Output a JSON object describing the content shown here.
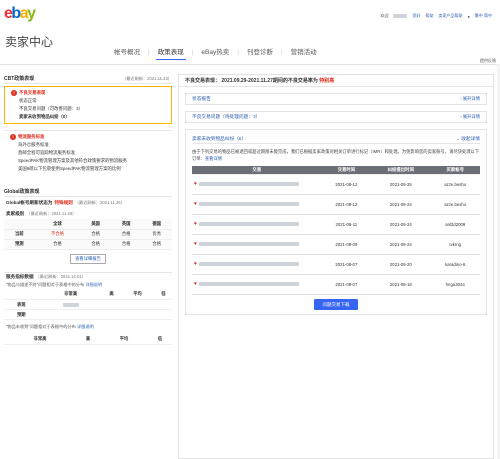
{
  "header": {
    "username": "",
    "account": "",
    "hello": "欢迎",
    "links": [
      "您好",
      "帮助",
      "卖家产品帮助"
    ],
    "lang": "繁中 简中"
  },
  "title": "卖家中心",
  "nav": [
    "帐号概况",
    "政策表现",
    "eBay热卖",
    "刊登诊断",
    "营销活动"
  ],
  "nav_active": 1,
  "feedback": "提供反馈",
  "left": {
    "cbt_title": "CBT政策表现",
    "cbt_date": "（最近刷新：2021.11.23）",
    "bad_title": "不良交易表现",
    "bad_items": [
      "状态正常",
      "不良交易问题（可改善问题：3）",
      "卖家未收到物品纠纷（0）"
    ],
    "bad_count3": "3",
    "ship_title": "物流服务标准",
    "ship_items": [
      "海外仓服务标准",
      "直邮全程可追踪物流服务标准",
      "SpeedPAK物流管理方案及其他符合政策要求的物流服务",
      "美国6磅以下包裹使用SpeedPAK物流管理方案的比例"
    ],
    "global_title": "Global政策表现",
    "global_status_label": "Global帐号刷新状态为",
    "global_status": "特殊规则",
    "global_date": "（最近刷新：2021.11.26）",
    "seller_title": "卖家级别",
    "seller_date": "（最近刷新：2021.11.26）",
    "seller_table": {
      "headers": [
        "",
        "全球",
        "美国",
        "英国",
        "德国"
      ],
      "rows": [
        [
          "当前",
          "不合格",
          "合格",
          "合格",
          "优秀"
        ],
        [
          "预测",
          "合格",
          "合格",
          "合格",
          "合格"
        ]
      ]
    },
    "seller_btn": "查看详细报告",
    "svc_title": "服务指标数据",
    "svc_date": "（最近刷新：2021.12.01）",
    "svc_note1": "“物品与描述不符”问题相对于表格中的分布",
    "svc_link1": "详细说明",
    "svc_table": {
      "headers": [
        "",
        "非常高",
        "高",
        "平均",
        "低"
      ],
      "rows": [
        [
          "表现",
          "",
          " ",
          " ",
          " "
        ],
        [
          "预期",
          "",
          "",
          "",
          ""
        ]
      ]
    },
    "svc_note2": "“物品未收到”问题相对于表格中的分布",
    "svc_link2": "详细说明",
    "svc_table2_headers": [
      "",
      "非常高",
      "高",
      "平均",
      "低"
    ]
  },
  "right": {
    "head": "不良交易表现：",
    "period": "2021.09.29-2021.11.27期间的不良交易率为",
    "rate_label": "特别高",
    "acc1": "状态报告",
    "acc1_act": "展开详情",
    "acc2": "不良交易问题（待处理问题：3）",
    "acc2_count": "3",
    "acc2_act": "展开详情",
    "open_title": "卖家未收到物品纠纷（6）",
    "open_act": "收起详情",
    "desc": "由于下列交易的物品已被退回或超过期限未能完成，我们已根据卖家政策对相关订单进行标记（IMR）和处理。为免影响您的卖家账号，请尽快处理以下订单：",
    "desc_link": "查看详情",
    "table": {
      "headers": [
        "交易",
        "交易时间",
        "纠纷提出时间",
        "买家帐号"
      ],
      "rows": [
        [
          "",
          "2021-08-12",
          "2021-09-25",
          "azze.besho"
        ],
        [
          "",
          "2021-08-12",
          "2021-09-24",
          "azze.besho"
        ],
        [
          "",
          "2021-08-11",
          "2021-09-24",
          "anl2d2009"
        ],
        [
          "",
          "2021-08-09",
          "2021-09-24",
          "tvkrng"
        ],
        [
          "",
          "2021-08-07",
          "2021-09-20",
          "karadino-6"
        ],
        [
          "",
          "2021-08-07",
          "2021-09-18",
          "hngu3044"
        ]
      ]
    },
    "download": "问题交易下载"
  },
  "colors": {
    "ebay_e": "#e53238",
    "ebay_b": "#0064d2",
    "ebay_a": "#f5af02",
    "ebay_y": "#86b817",
    "accent": "#3665f3"
  }
}
